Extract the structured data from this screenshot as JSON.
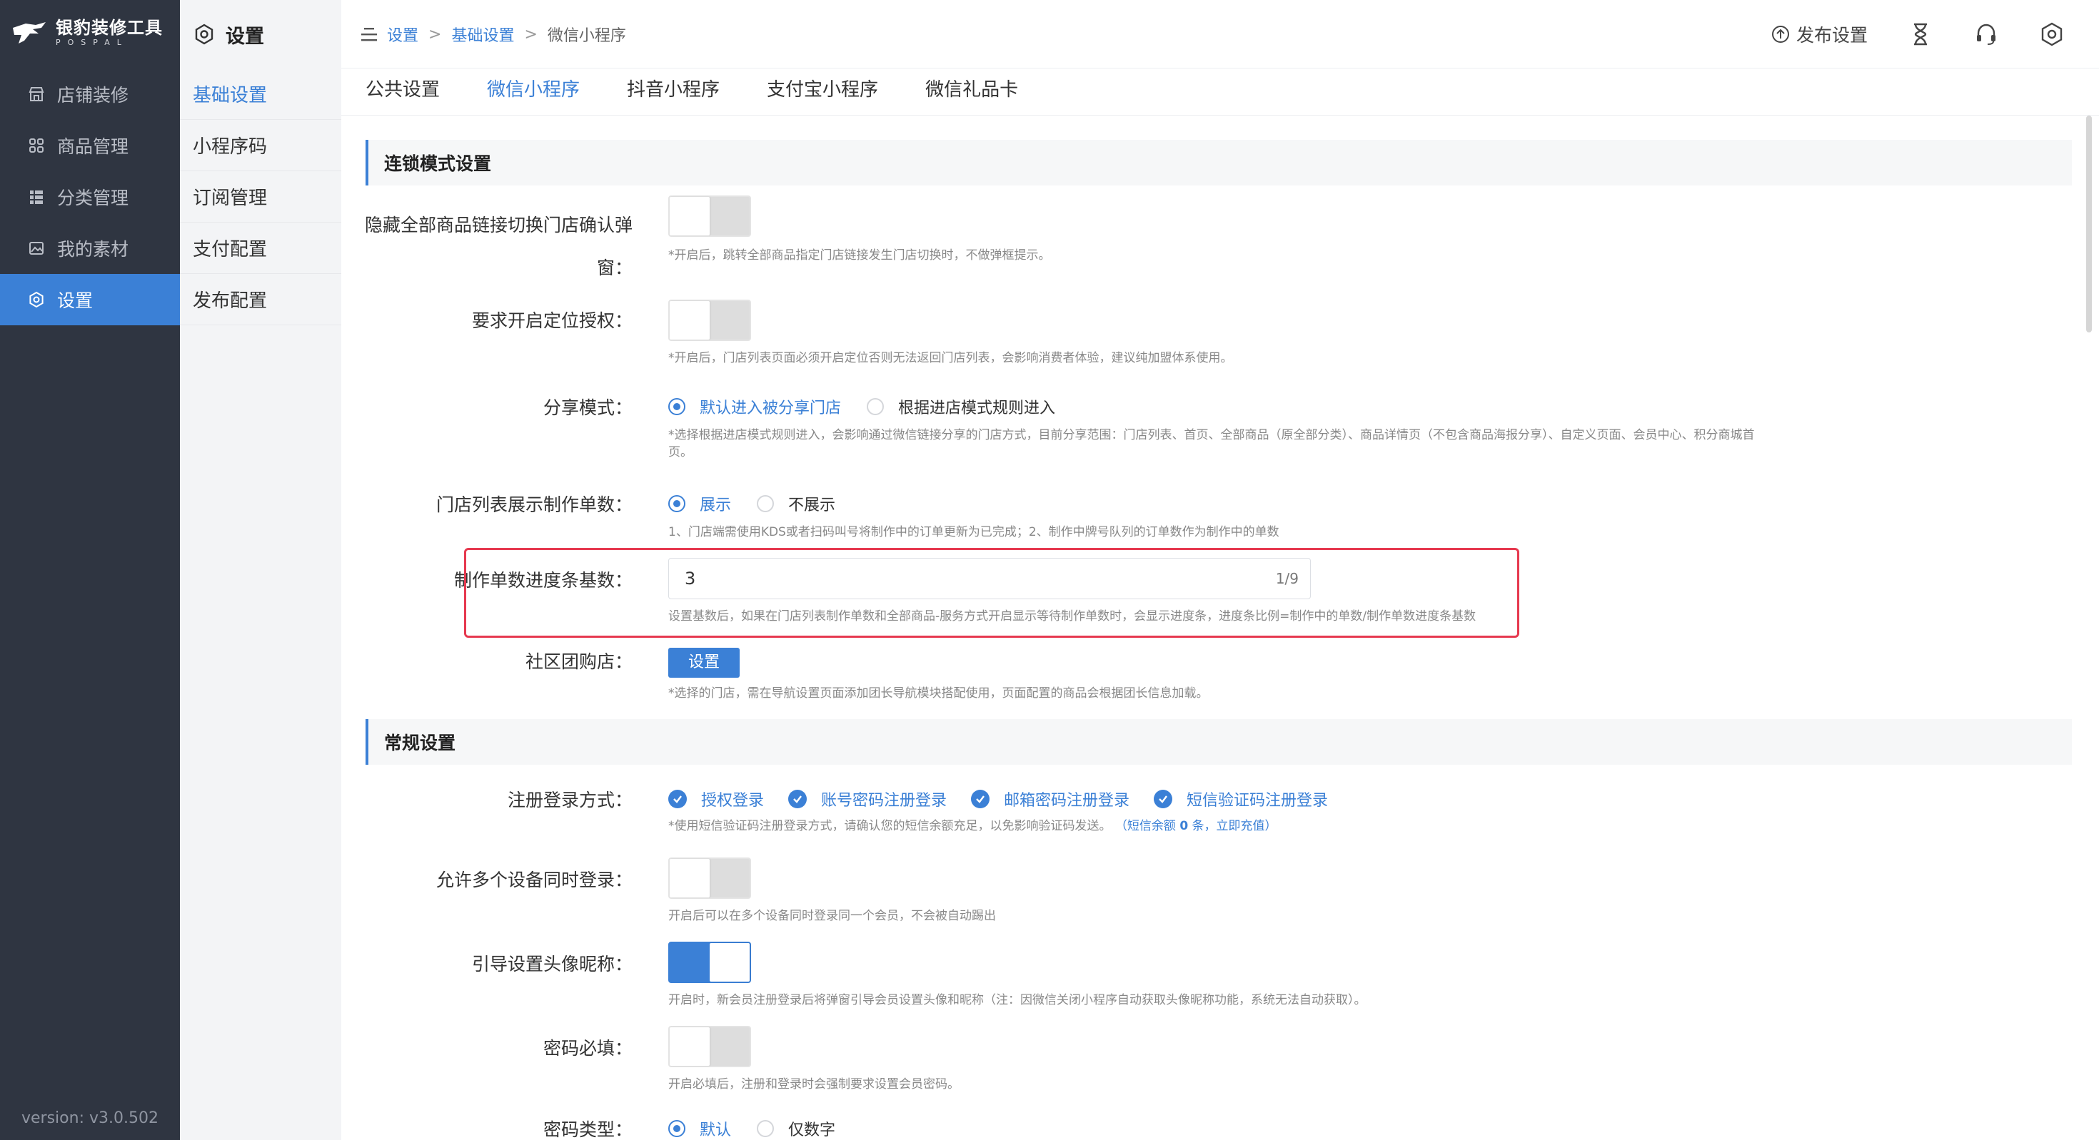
{
  "app": {
    "logo_title": "银豹装修工具",
    "logo_sub": "POSPAL",
    "version": "version: v3.0.502"
  },
  "sidebar": {
    "items": [
      {
        "label": "店铺装修",
        "icon": "store-icon"
      },
      {
        "label": "商品管理",
        "icon": "grid-icon"
      },
      {
        "label": "分类管理",
        "icon": "list-icon"
      },
      {
        "label": "我的素材",
        "icon": "image-icon"
      },
      {
        "label": "设置",
        "icon": "gear-icon",
        "active": true
      }
    ]
  },
  "subside": {
    "title": "设置",
    "items": [
      {
        "label": "基础设置",
        "active": true
      },
      {
        "label": "小程序码"
      },
      {
        "label": "订阅管理"
      },
      {
        "label": "支付配置"
      },
      {
        "label": "发布配置"
      }
    ]
  },
  "breadcrumb": {
    "items": [
      "设置",
      "基础设置",
      "微信小程序"
    ],
    "sep": ">"
  },
  "topbar": {
    "publish_label": "发布设置"
  },
  "tabs": [
    {
      "label": "公共设置"
    },
    {
      "label": "微信小程序",
      "active": true
    },
    {
      "label": "抖音小程序"
    },
    {
      "label": "支付宝小程序"
    },
    {
      "label": "微信礼品卡"
    }
  ],
  "sections": {
    "chain": {
      "title": "连锁模式设置",
      "hide_confirm": {
        "label_line1": "隐藏全部商品链接切换门店确认弹",
        "label_line2": "窗：",
        "on": false,
        "desc": "*开启后，跳转全部商品指定门店链接发生门店切换时，不做弹框提示。"
      },
      "location_auth": {
        "label": "要求开启定位授权：",
        "on": false,
        "desc": "*开启后，门店列表页面必须开启定位否则无法返回门店列表，会影响消费者体验，建议纯加盟体系使用。"
      },
      "share_mode": {
        "label": "分享模式：",
        "options": [
          "默认进入被分享门店",
          "根据进店模式规则进入"
        ],
        "selected": 0,
        "desc_line1": "*选择根据进店模式规则进入，会影响通过微信链接分享的门店方式，目前分享范围：门店列表、首页、全部商品（原全部分类）、商品详情页（不包含商品海报分享）、自定义页面、会员中心、积分商城首",
        "desc_line2": "页。"
      },
      "show_orders": {
        "label": "门店列表展示制作单数：",
        "options": [
          "展示",
          "不展示"
        ],
        "selected": 0,
        "desc": "1、门店端需使用KDS或者扫码叫号将制作中的订单更新为已完成；2、制作中牌号队列的订单数作为制作中的单数"
      },
      "progress_base": {
        "label": "制作单数进度条基数：",
        "value": "3",
        "counter": "1/9",
        "desc": "设置基数后，如果在门店列表制作单数和全部商品-服务方式开启显示等待制作单数时，会显示进度条，进度条比例=制作中的单数/制作单数进度条基数"
      },
      "group_buy": {
        "label": "社区团购店：",
        "button": "设置",
        "desc": "*选择的门店，需在导航设置页面添加团长导航模块搭配使用，页面配置的商品会根据团长信息加载。"
      }
    },
    "general": {
      "title": "常规设置",
      "login_methods": {
        "label": "注册登录方式：",
        "options": [
          "授权登录",
          "账号密码注册登录",
          "邮箱密码注册登录",
          "短信验证码注册登录"
        ],
        "desc_prefix": "*使用短信验证码注册登录方式，请确认您的短信余额充足，以免影响验证码发送。",
        "desc_link_a": "（短信余额 ",
        "desc_link_count": "0",
        "desc_link_b": " 条，立即充值）"
      },
      "multi_device": {
        "label": "允许多个设备同时登录：",
        "on": false,
        "desc": "开启后可以在多个设备同时登录同一个会员，不会被自动踢出"
      },
      "avatar_guide": {
        "label": "引导设置头像昵称：",
        "on": true,
        "desc": "开启时，新会员注册登录后将弹窗引导会员设置头像和昵称（注：因微信关闭小程序自动获取头像昵称功能，系统无法自动获取）。"
      },
      "password_required": {
        "label": "密码必填：",
        "on": false,
        "desc": "开启必填后，注册和登录时会强制要求设置会员密码。"
      },
      "password_type": {
        "label": "密码类型：",
        "options": [
          "默认",
          "仅数字"
        ],
        "selected": 0
      }
    }
  },
  "colors": {
    "accent": "#3b80d6",
    "sidebar_bg": "#2f3541",
    "highlight": "#e6394f"
  }
}
